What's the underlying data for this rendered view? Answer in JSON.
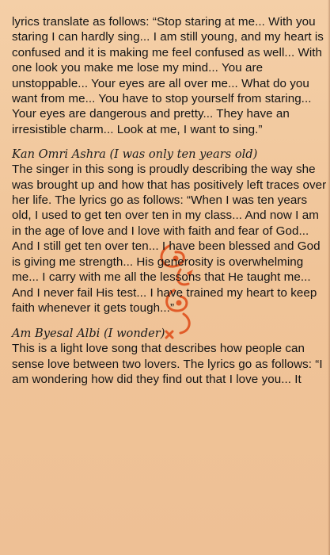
{
  "document": {
    "intro_paragraph": "lyrics translate as follows: “Stop staring at me... With you staring I can hardly sing... I am still young, and my heart is confused and it is making me feel confused as well... With one look you make me lose my mind... You are unstoppable... Your eyes are all over me... What do you want from me... You have to stop yourself from staring... Your eyes are dangerous and pretty... They have an irresistible charm... Look at me, I want to sing.”",
    "section_1": {
      "heading": "Kan Omri Ashra (I was only ten years old)",
      "body": "The singer in this song is proudly describing the way she was brought up and how that has positively left traces over her life. The lyrics go as follows: “When I was ten years old, I used to get ten over ten in my class... And now I am in the age of love and I love with faith and fear of God... And I still get ten over ten... I have been blessed and God is giving me strength... His generosity is overwhelming me... I carry with me all the lessons that He taught me... And I never fail His test... I have trained my heart to keep faith whenever it gets tough...”"
    },
    "section_2": {
      "heading": "Am Byesal Albi (I wonder)",
      "body": "This is a light love song that describes how people can sense love between two lovers. The lyrics go as follows: “I am wondering how did they find out that I love you... It"
    }
  },
  "colors": {
    "background": "#f2c9a0",
    "text": "#141414",
    "decoration": "#e0501c"
  },
  "decoration_icon": "ornamental-swirl-icon"
}
